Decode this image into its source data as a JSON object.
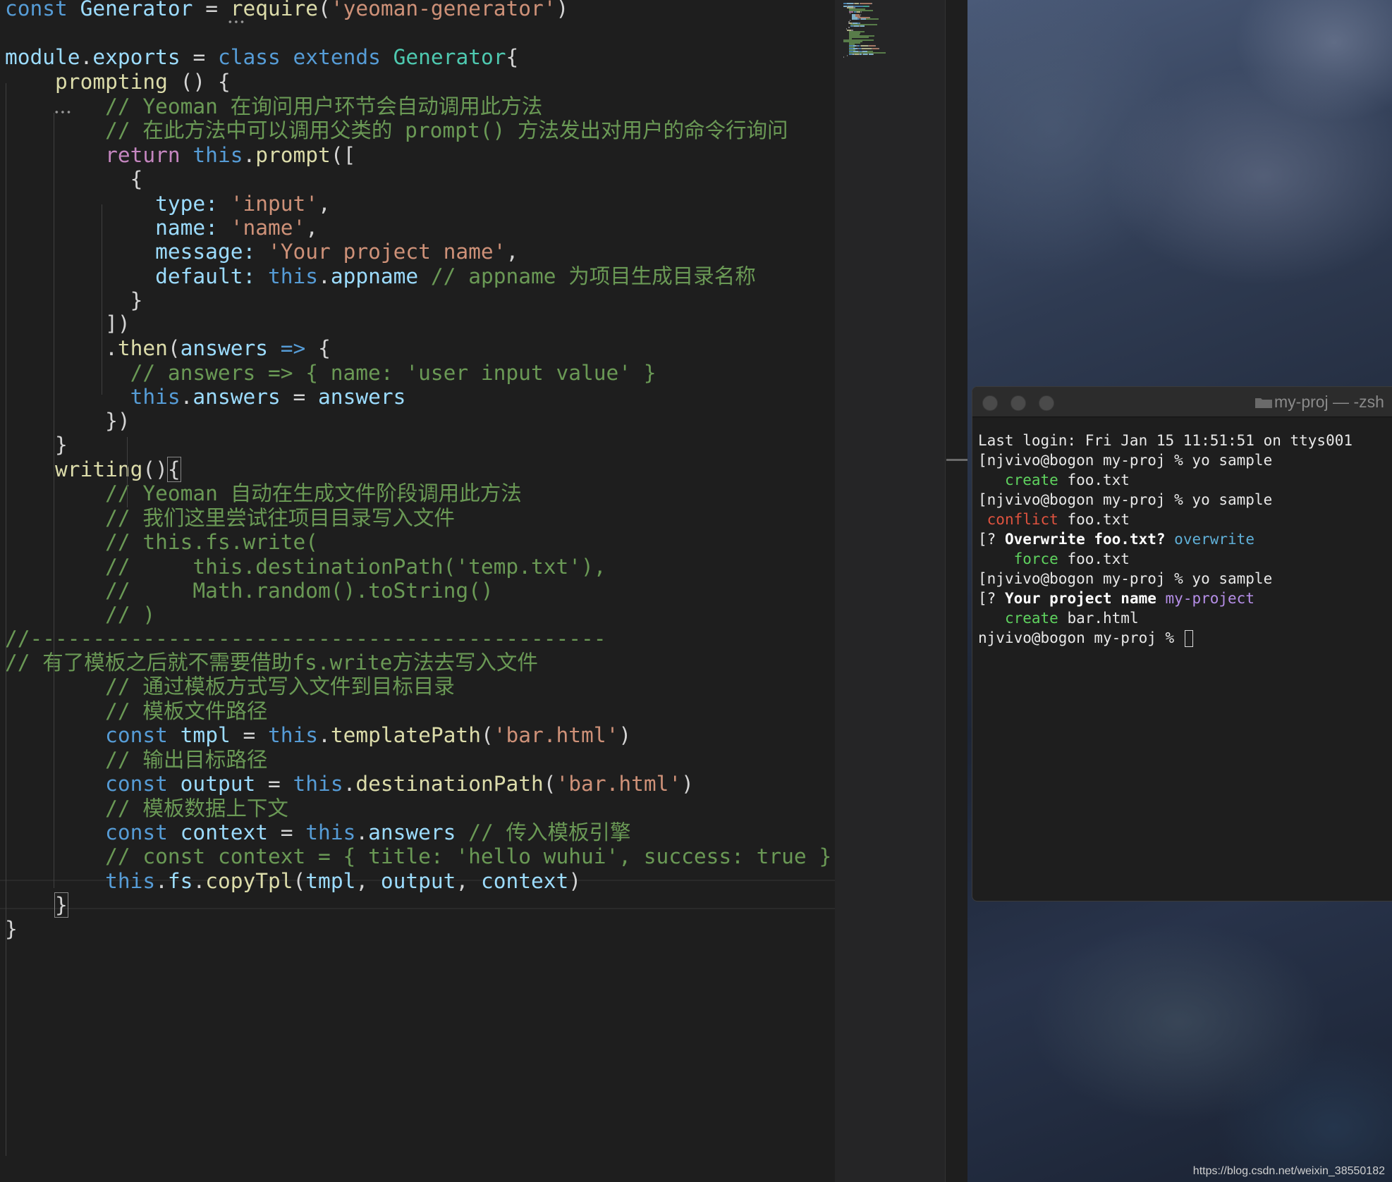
{
  "editor": {
    "lines": [
      {
        "tokens": [
          [
            "k",
            "const "
          ],
          [
            "v",
            "Generator "
          ],
          [
            "p",
            "= "
          ],
          [
            "f",
            "require"
          ],
          [
            "p",
            "("
          ],
          [
            "s",
            "'yeoman-generator'"
          ],
          [
            "p",
            ")"
          ]
        ]
      },
      {
        "tokens": []
      },
      {
        "tokens": [
          [
            "v",
            "module"
          ],
          [
            "p",
            "."
          ],
          [
            "v",
            "exports "
          ],
          [
            "p",
            "= "
          ],
          [
            "k",
            "class "
          ],
          [
            "k",
            "extends "
          ],
          [
            "t",
            "Generator"
          ],
          [
            "p",
            "{"
          ]
        ]
      },
      {
        "tokens": [
          [
            "p",
            "    "
          ],
          [
            "f",
            "prompting "
          ],
          [
            "p",
            "() {"
          ]
        ]
      },
      {
        "tokens": [
          [
            "p",
            "        "
          ],
          [
            "c",
            "// Yeoman 在询问用户环节会自动调用此方法"
          ]
        ]
      },
      {
        "tokens": [
          [
            "p",
            "        "
          ],
          [
            "c",
            "// 在此方法中可以调用父类的 prompt() 方法发出对用户的命令行询问"
          ]
        ]
      },
      {
        "tokens": [
          [
            "p",
            "        "
          ],
          [
            "r",
            "return "
          ],
          [
            "k",
            "this"
          ],
          [
            "p",
            "."
          ],
          [
            "f",
            "prompt"
          ],
          [
            "p",
            "(["
          ]
        ]
      },
      {
        "tokens": [
          [
            "p",
            "          {"
          ]
        ]
      },
      {
        "tokens": [
          [
            "p",
            "            "
          ],
          [
            "v",
            "type"
          ],
          [
            "v",
            ": "
          ],
          [
            "s",
            "'input'"
          ],
          [
            "p",
            ","
          ]
        ]
      },
      {
        "tokens": [
          [
            "p",
            "            "
          ],
          [
            "v",
            "name"
          ],
          [
            "v",
            ": "
          ],
          [
            "s",
            "'name'"
          ],
          [
            "p",
            ","
          ]
        ]
      },
      {
        "tokens": [
          [
            "p",
            "            "
          ],
          [
            "v",
            "message"
          ],
          [
            "v",
            ": "
          ],
          [
            "s",
            "'Your project name'"
          ],
          [
            "p",
            ","
          ]
        ]
      },
      {
        "tokens": [
          [
            "p",
            "            "
          ],
          [
            "v",
            "default"
          ],
          [
            "v",
            ": "
          ],
          [
            "k",
            "this"
          ],
          [
            "p",
            "."
          ],
          [
            "v",
            "appname "
          ],
          [
            "c",
            "// appname 为项目生成目录名称"
          ]
        ]
      },
      {
        "tokens": [
          [
            "p",
            "          }"
          ]
        ]
      },
      {
        "tokens": [
          [
            "p",
            "        ])"
          ]
        ]
      },
      {
        "tokens": [
          [
            "p",
            "        ."
          ],
          [
            "f",
            "then"
          ],
          [
            "p",
            "("
          ],
          [
            "v",
            "answers "
          ],
          [
            "k",
            "=> "
          ],
          [
            "p",
            "{"
          ]
        ]
      },
      {
        "tokens": [
          [
            "p",
            "          "
          ],
          [
            "c",
            "// answers => { name: 'user input value' }"
          ]
        ]
      },
      {
        "tokens": [
          [
            "p",
            "          "
          ],
          [
            "k",
            "this"
          ],
          [
            "p",
            "."
          ],
          [
            "v",
            "answers "
          ],
          [
            "p",
            "= "
          ],
          [
            "v",
            "answers"
          ]
        ]
      },
      {
        "tokens": [
          [
            "p",
            "        })"
          ]
        ]
      },
      {
        "tokens": [
          [
            "p",
            "    }"
          ]
        ]
      },
      {
        "tokens": [
          [
            "p",
            "    "
          ],
          [
            "f",
            "writing"
          ],
          [
            "p",
            "()"
          ],
          [
            "pb",
            "{"
          ]
        ]
      },
      {
        "tokens": [
          [
            "p",
            "        "
          ],
          [
            "c",
            "// Yeoman 自动在生成文件阶段调用此方法"
          ]
        ]
      },
      {
        "tokens": [
          [
            "p",
            "        "
          ],
          [
            "c",
            "// 我们这里尝试往项目目录写入文件"
          ]
        ]
      },
      {
        "tokens": [
          [
            "p",
            "        "
          ],
          [
            "c",
            "// this.fs.write("
          ]
        ]
      },
      {
        "tokens": [
          [
            "p",
            "        "
          ],
          [
            "c",
            "//     this.destinationPath('temp.txt'),"
          ]
        ]
      },
      {
        "tokens": [
          [
            "p",
            "        "
          ],
          [
            "c",
            "//     Math.random().toString()"
          ]
        ]
      },
      {
        "tokens": [
          [
            "p",
            "        "
          ],
          [
            "c",
            "// )"
          ]
        ]
      },
      {
        "tokens": [
          [
            "c",
            "//----------------------------------------------"
          ]
        ]
      },
      {
        "tokens": [
          [
            "c",
            "// 有了模板之后就不需要借助fs.write方法去写入文件"
          ]
        ]
      },
      {
        "tokens": [
          [
            "p",
            "        "
          ],
          [
            "c",
            "// 通过模板方式写入文件到目标目录"
          ]
        ]
      },
      {
        "tokens": [
          [
            "p",
            "        "
          ],
          [
            "c",
            "// 模板文件路径"
          ]
        ]
      },
      {
        "tokens": [
          [
            "p",
            "        "
          ],
          [
            "k",
            "const "
          ],
          [
            "v",
            "tmpl "
          ],
          [
            "p",
            "= "
          ],
          [
            "k",
            "this"
          ],
          [
            "p",
            "."
          ],
          [
            "f",
            "templatePath"
          ],
          [
            "p",
            "("
          ],
          [
            "s",
            "'bar.html'"
          ],
          [
            "p",
            ")"
          ]
        ]
      },
      {
        "tokens": [
          [
            "p",
            "        "
          ],
          [
            "c",
            "// 输出目标路径"
          ]
        ]
      },
      {
        "tokens": [
          [
            "p",
            "        "
          ],
          [
            "k",
            "const "
          ],
          [
            "v",
            "output "
          ],
          [
            "p",
            "= "
          ],
          [
            "k",
            "this"
          ],
          [
            "p",
            "."
          ],
          [
            "f",
            "destinationPath"
          ],
          [
            "p",
            "("
          ],
          [
            "s",
            "'bar.html'"
          ],
          [
            "p",
            ")"
          ]
        ]
      },
      {
        "tokens": [
          [
            "p",
            "        "
          ],
          [
            "c",
            "// 模板数据上下文"
          ]
        ]
      },
      {
        "tokens": [
          [
            "p",
            "        "
          ],
          [
            "k",
            "const "
          ],
          [
            "v",
            "context "
          ],
          [
            "p",
            "= "
          ],
          [
            "k",
            "this"
          ],
          [
            "p",
            "."
          ],
          [
            "v",
            "answers "
          ],
          [
            "c",
            "// 传入模板引擎"
          ]
        ]
      },
      {
        "tokens": [
          [
            "p",
            "        "
          ],
          [
            "c",
            "// const context = { title: 'hello wuhui', success: true }"
          ]
        ]
      },
      {
        "tokens": [
          [
            "p",
            "        "
          ],
          [
            "k",
            "this"
          ],
          [
            "p",
            "."
          ],
          [
            "v",
            "fs"
          ],
          [
            "p",
            "."
          ],
          [
            "f",
            "copyTpl"
          ],
          [
            "p",
            "("
          ],
          [
            "v",
            "tmpl"
          ],
          [
            "p",
            ", "
          ],
          [
            "v",
            "output"
          ],
          [
            "p",
            ", "
          ],
          [
            "v",
            "context"
          ],
          [
            "p",
            ")"
          ]
        ]
      },
      {
        "tokens": [
          [
            "p",
            "    "
          ],
          [
            "pb",
            "}"
          ]
        ]
      },
      {
        "tokens": [
          [
            "p",
            "}"
          ]
        ]
      }
    ]
  },
  "terminal": {
    "title": "my-proj — -zsh",
    "lines": [
      [
        [
          "d",
          "Last login: Fri Jan 15 11:51:51 on ttys001"
        ]
      ],
      [
        [
          "d",
          "[njvivo@bogon my-proj % yo sample"
        ]
      ],
      [
        [
          "d",
          "   "
        ],
        [
          "g",
          "create"
        ],
        [
          "d",
          " foo.txt"
        ]
      ],
      [
        [
          "d",
          "[njvivo@bogon my-proj % yo sample"
        ]
      ],
      [
        [
          "d",
          " "
        ],
        [
          "r",
          "conflict"
        ],
        [
          "d",
          " foo.txt"
        ]
      ],
      [
        [
          "d",
          "[? "
        ],
        [
          "b",
          "Overwrite foo.txt?"
        ],
        [
          "d",
          " "
        ],
        [
          "c",
          "overwrite"
        ]
      ],
      [
        [
          "d",
          "    "
        ],
        [
          "g",
          "force"
        ],
        [
          "d",
          " foo.txt"
        ]
      ],
      [
        [
          "d",
          "[njvivo@bogon my-proj % yo sample"
        ]
      ],
      [
        [
          "d",
          "[? "
        ],
        [
          "b",
          "Your project name"
        ],
        [
          "d",
          " "
        ],
        [
          "m",
          "my-project"
        ]
      ],
      [
        [
          "d",
          "   "
        ],
        [
          "g",
          "create"
        ],
        [
          "d",
          " bar.html"
        ]
      ],
      [
        [
          "d",
          "njvivo@bogon my-proj % "
        ],
        [
          "cursor",
          ""
        ]
      ]
    ]
  },
  "watermark": "https://blog.csdn.net/weixin_38550182",
  "colors": {
    "keyword": "#569cd6",
    "control": "#c586c0",
    "variable": "#9cdcfe",
    "function": "#dcdcaa",
    "string": "#ce9178",
    "comment": "#6a9955",
    "class": "#4ec9b0",
    "plain": "#d4d4d4"
  }
}
